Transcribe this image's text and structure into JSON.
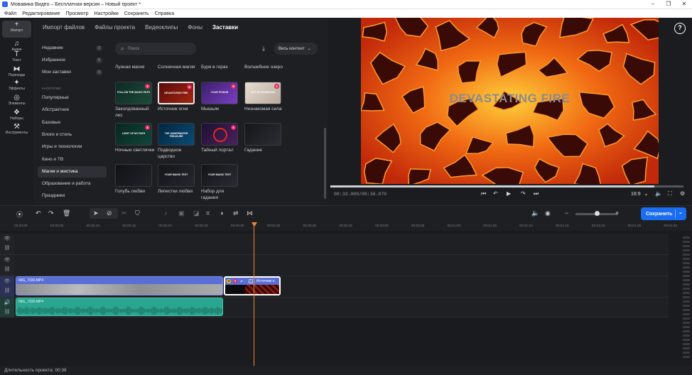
{
  "window": {
    "title": "Мовавика Видео – Бесплатная версия – Новый проект *"
  },
  "menu": [
    "Файл",
    "Редактирование",
    "Просмотр",
    "Настройки",
    "Сохранить",
    "Справка"
  ],
  "rail": [
    {
      "icon": "plus-icon",
      "glyph": "+",
      "label": "Импорт"
    },
    {
      "icon": "music-icon",
      "glyph": "♫",
      "label": "Аудио"
    },
    {
      "icon": "text-icon",
      "glyph": "T",
      "label": "Текст"
    },
    {
      "icon": "transitions-icon",
      "glyph": "⧓",
      "label": "Переходы"
    },
    {
      "icon": "effects-icon",
      "glyph": "✦",
      "label": "Эффекты"
    },
    {
      "icon": "elements-icon",
      "glyph": "◎",
      "label": "Элементы"
    },
    {
      "icon": "sets-icon",
      "glyph": "❖",
      "label": "Наборы"
    },
    {
      "icon": "tools-icon",
      "glyph": "⚒",
      "label": "Инструменты"
    }
  ],
  "tabs": [
    "Импорт файлов",
    "Файлы проекта",
    "Видеоклипы",
    "Фоны",
    "Заставки"
  ],
  "categories": {
    "top": [
      {
        "label": "Недавние",
        "count": "2"
      },
      {
        "label": "Избранное",
        "count": "0"
      },
      {
        "label": "Мои заставки",
        "count": "0"
      }
    ],
    "header": "КАТЕГОРИИ",
    "list": [
      "Популярные",
      "Абстрактное",
      "Базовые",
      "Влоги и стиль",
      "Игры и технологии",
      "Кино и ТВ",
      "Магия и мистика",
      "Образование и работа",
      "Праздники"
    ]
  },
  "search": {
    "placeholder": "Поиск"
  },
  "filter": {
    "label": "Весь контент"
  },
  "top_labels": [
    "Лунная магия",
    "Солнечная магия",
    "Буря в горах",
    "Волшебное озеро"
  ],
  "tiles": [
    {
      "label": "Заколдованный лес",
      "thumb": "FOLLOW THE MAGIC PATH"
    },
    {
      "label": "Источник огня",
      "thumb": "DEVASTATING FIRE"
    },
    {
      "label": "Мышьяк",
      "thumb": "YOUR POISON"
    },
    {
      "label": "Незнакомая сила",
      "thumb": "ART OF DIVINATION"
    },
    {
      "label": "Ночные светлячки",
      "thumb": "LIGHT UP MY PATH"
    },
    {
      "label": "Подводное царство",
      "thumb": "THE UNDERWATER TREASURE"
    },
    {
      "label": "Тайный портал",
      "thumb": ""
    },
    {
      "label": "Гадание",
      "thumb": ""
    },
    {
      "label": "Голубь любви",
      "thumb": ""
    },
    {
      "label": "Лепестки любви",
      "thumb": "YOUR MAGIC TEXT"
    },
    {
      "label": "Набор для гадания",
      "thumb": "YOUR MAGIC TEXT"
    }
  ],
  "preview": {
    "title": "DEVASTATING FIRE",
    "progress": 0.917
  },
  "player": {
    "timecode": "00:33.000/00:36.070",
    "ratio": "16:9"
  },
  "save": {
    "label": "Сохранить"
  },
  "ruler": [
    "00:00:00",
    "00:00:05",
    "00:00:10",
    "00:00:15",
    "00:00:20",
    "00:00:25",
    "00:00:30",
    "00:00:35",
    "00:00:40",
    "00:00:45",
    "00:00:50",
    "00:00:55",
    "00:01:00",
    "00:01:05",
    "00:01:10",
    "00:01:15",
    "00:01:20",
    "00:01:25",
    "00:01:30"
  ],
  "clips": {
    "video": "IMG_7330.MP4",
    "title": "Источник о",
    "audio": "IMG_7330.MP4"
  },
  "status": {
    "duration": "Длительность проекта: 00:36"
  }
}
